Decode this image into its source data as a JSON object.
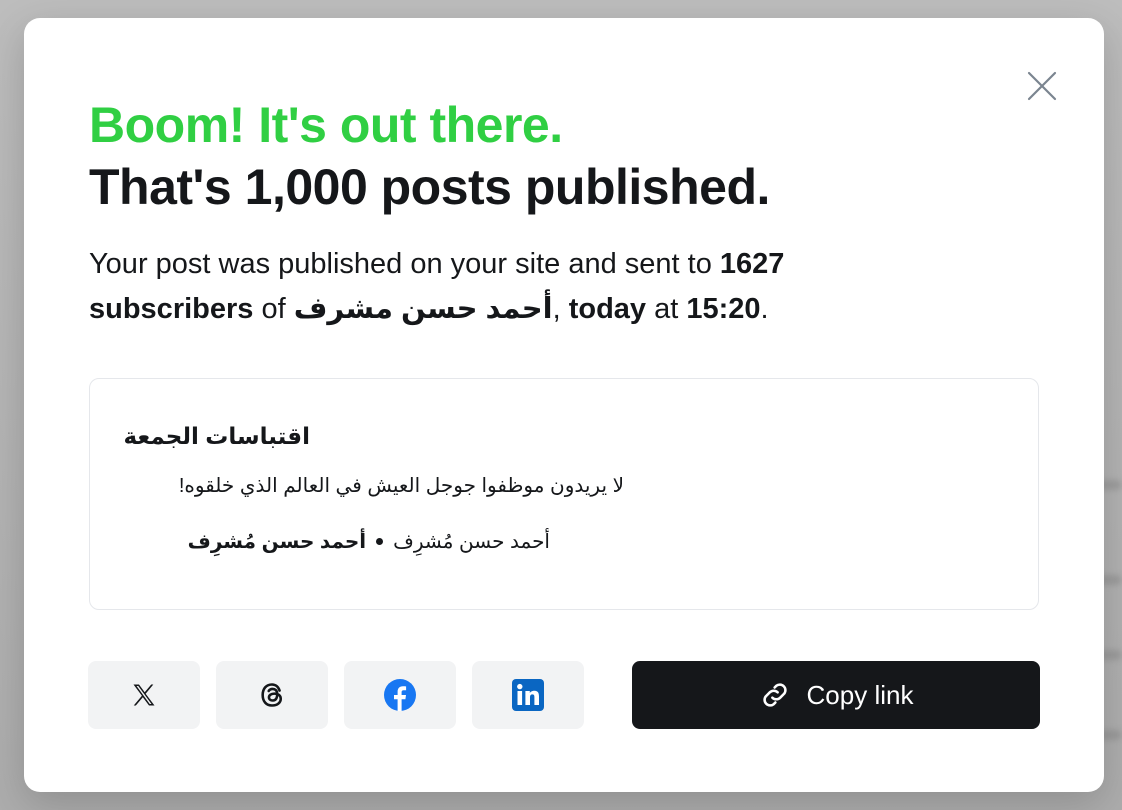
{
  "modal": {
    "headline_green": "Boom! It's out there.",
    "headline_dark": "That's 1,000 posts published."
  },
  "description": {
    "prefix": "Your post was published on your site and sent to ",
    "subscriber_count": "1627",
    "subscribers_word": "subscribers",
    "of_text": " of ",
    "site_name": "أحمد حسن مشرف",
    "comma": ", ",
    "today_word": "today",
    "at_text": " at ",
    "time": "15:20",
    "period": "."
  },
  "preview": {
    "title": "اقتباسات الجمعة",
    "excerpt": "لا يريدون موظفوا جوجل العيش في العالم الذي خلقوه!",
    "author_bold": "أحمد حسن مُشرِف",
    "author_regular": "أحمد حسن مُشرِف"
  },
  "share": {
    "buttons": [
      {
        "icon": "x-twitter-icon"
      },
      {
        "icon": "threads-icon"
      },
      {
        "icon": "facebook-icon"
      },
      {
        "icon": "linkedin-icon"
      }
    ],
    "copy_label": "Copy link"
  },
  "colors": {
    "accent_green": "#30cf43",
    "dark": "#15171a",
    "facebook_blue": "#1877f2",
    "linkedin_blue": "#0a66c2"
  }
}
